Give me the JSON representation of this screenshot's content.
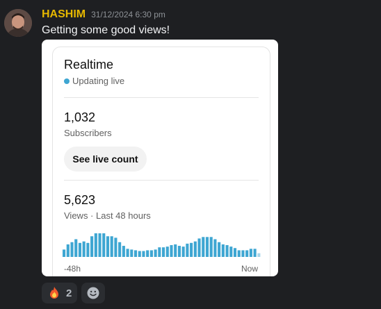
{
  "message": {
    "username": "HASHIM",
    "timestamp": "31/12/2024 6:30 pm",
    "text": "Getting some good views!"
  },
  "card": {
    "title": "Realtime",
    "live_status": "Updating live",
    "subscribers_value": "1,032",
    "subscribers_label": "Subscribers",
    "live_count_button": "See live count",
    "views_value": "5,623",
    "views_label": "Views · Last 48 hours",
    "axis_start": "-48h",
    "axis_end": "Now"
  },
  "chart_data": {
    "type": "bar",
    "values": [
      10,
      17,
      20,
      24,
      19,
      21,
      19,
      28,
      32,
      32,
      32,
      28,
      28,
      26,
      20,
      15,
      11,
      10,
      9,
      8,
      8,
      9,
      9,
      10,
      13,
      13,
      14,
      16,
      17,
      15,
      14,
      18,
      19,
      21,
      25,
      27,
      27,
      27,
      24,
      20,
      17,
      16,
      14,
      12,
      9,
      9,
      9,
      11,
      11,
      5
    ],
    "xlabel_start": "-48h",
    "xlabel_end": "Now",
    "bar_color": "#3ea6d2"
  },
  "reactions": {
    "fire_count": "2"
  },
  "colors": {
    "username": "#e6b800",
    "background": "#1e1f22",
    "accent": "#3ea6d2"
  },
  "icons": {
    "reaction_emoji": "fire-icon",
    "add_reaction": "smiley-icon"
  }
}
